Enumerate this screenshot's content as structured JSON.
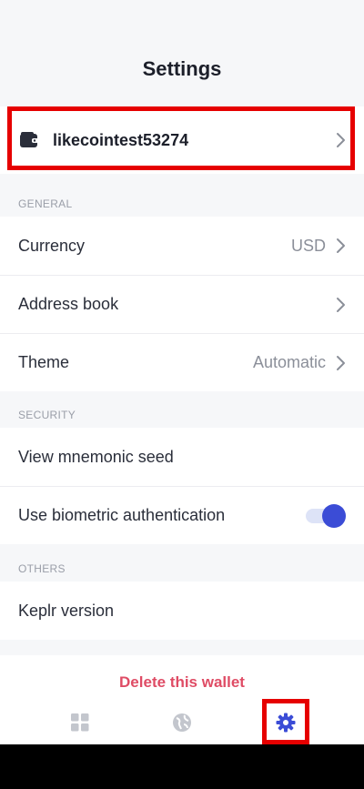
{
  "header": {
    "title": "Settings"
  },
  "wallet": {
    "name": "likecointest53274",
    "icon": "wallet-icon"
  },
  "sections": {
    "general": "GENERAL",
    "security": "SECURITY",
    "others": "OTHERS"
  },
  "general": {
    "currency": {
      "label": "Currency",
      "value": "USD"
    },
    "address_book": {
      "label": "Address book"
    },
    "theme": {
      "label": "Theme",
      "value": "Automatic"
    }
  },
  "security": {
    "mnemonic": {
      "label": "View mnemonic seed"
    },
    "biometric": {
      "label": "Use biometric authentication",
      "enabled": true
    }
  },
  "others": {
    "version": {
      "label": "Keplr version"
    }
  },
  "footer": {
    "delete_label": "Delete this wallet"
  },
  "tabbar": {
    "tabs": [
      {
        "icon": "grid-icon",
        "active": false
      },
      {
        "icon": "globe-icon",
        "active": false
      },
      {
        "icon": "gear-icon",
        "active": true
      }
    ]
  },
  "colors": {
    "accent": "#3b4cd6",
    "danger": "#df4c65",
    "highlight": "#e60000"
  }
}
